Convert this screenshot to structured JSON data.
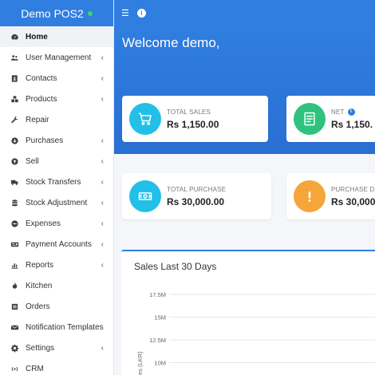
{
  "app": {
    "brand": "Demo POS2",
    "status_color": "#3fd06b"
  },
  "sidebar": {
    "items": [
      {
        "label": "Home",
        "icon": "dashboard-icon",
        "chevron": false,
        "active": true
      },
      {
        "label": "User Management",
        "icon": "users-icon",
        "chevron": true
      },
      {
        "label": "Contacts",
        "icon": "address-book-icon",
        "chevron": true
      },
      {
        "label": "Products",
        "icon": "cubes-icon",
        "chevron": true
      },
      {
        "label": "Repair",
        "icon": "wrench-icon",
        "chevron": false
      },
      {
        "label": "Purchases",
        "icon": "arrow-circle-down-icon",
        "chevron": true
      },
      {
        "label": "Sell",
        "icon": "arrow-circle-up-icon",
        "chevron": true
      },
      {
        "label": "Stock Transfers",
        "icon": "truck-icon",
        "chevron": true
      },
      {
        "label": "Stock Adjustment",
        "icon": "database-icon",
        "chevron": true
      },
      {
        "label": "Expenses",
        "icon": "minus-circle-icon",
        "chevron": true
      },
      {
        "label": "Payment Accounts",
        "icon": "money-check-icon",
        "chevron": true
      },
      {
        "label": "Reports",
        "icon": "bar-chart-icon",
        "chevron": true
      },
      {
        "label": "Kitchen",
        "icon": "fire-icon",
        "chevron": false
      },
      {
        "label": "Orders",
        "icon": "list-icon",
        "chevron": false
      },
      {
        "label": "Notification Templates",
        "icon": "envelope-icon",
        "chevron": false
      },
      {
        "label": "Settings",
        "icon": "cog-icon",
        "chevron": true
      },
      {
        "label": "CRM",
        "icon": "broadcast-icon",
        "chevron": false
      }
    ],
    "chevron_glyph": "‹"
  },
  "topbar": {
    "menu_glyph": "☰",
    "info_glyph": "i"
  },
  "welcome": "Welcome demo,",
  "cards": {
    "total_sales": {
      "label": "TOTAL SALES",
      "value": "Rs 1,150.00",
      "color": "#22c0e8",
      "icon": "cart-icon"
    },
    "net": {
      "label": "NET",
      "value": "Rs 1,150.",
      "color": "#2ec27e",
      "icon": "receipt-icon",
      "info": "i"
    },
    "total_purchase": {
      "label": "TOTAL PURCHASE",
      "value": "Rs 30,000.00",
      "color": "#22c0e8",
      "icon": "money-bill-icon"
    },
    "purchase_due": {
      "label": "PURCHASE D",
      "value": "Rs 30,000",
      "color": "#f5a53a",
      "icon": "exclamation-icon"
    }
  },
  "chart": {
    "title": "Sales Last 30 Days"
  },
  "chart_data": {
    "type": "line",
    "title": "Sales Last 30 Days",
    "ylabel": "es (LKR)",
    "y_ticks": [
      "17.5M",
      "15M",
      "12.5M",
      "10M"
    ],
    "y_tick_values": [
      17500000,
      15000000,
      12500000,
      10000000
    ],
    "grid": true,
    "series": []
  }
}
